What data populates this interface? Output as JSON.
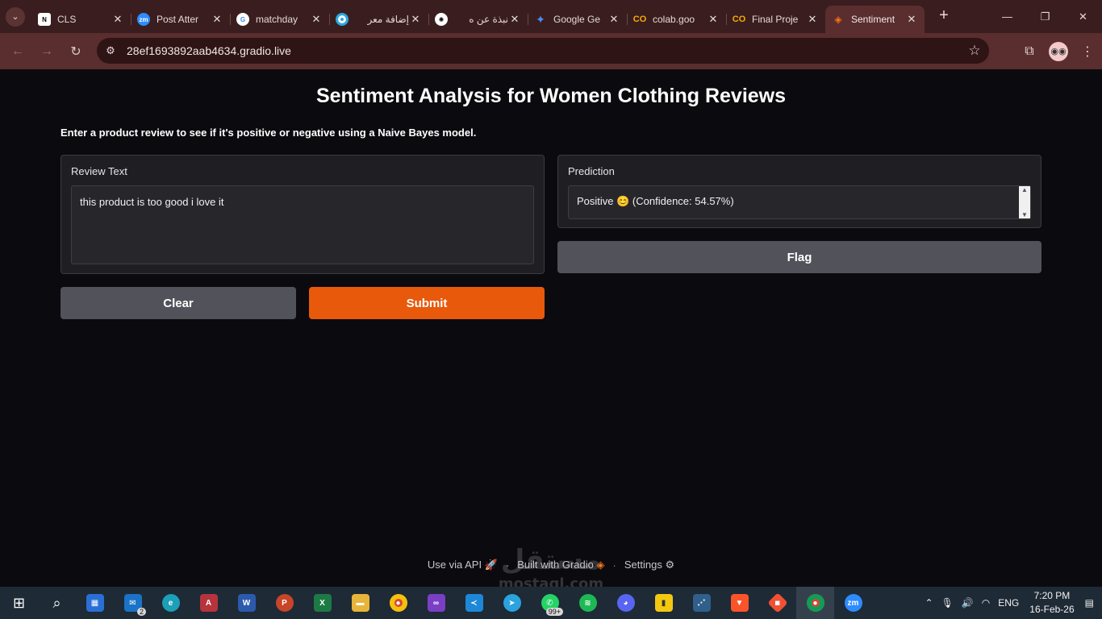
{
  "browser": {
    "tabs": [
      {
        "title": "CLS",
        "icon": "notion-icon",
        "color": "#ffffff"
      },
      {
        "title": "Post Atter",
        "icon": "zoom-icon",
        "color": "#2d8cff"
      },
      {
        "title": "matchday",
        "icon": "google-icon",
        "color": "#4285f4"
      },
      {
        "title": "إضافة معر",
        "icon": "mostaql-icon",
        "color": "#2aa8e0"
      },
      {
        "title": "نبذة عن ه",
        "icon": "chatgpt-icon",
        "color": "#ffffff"
      },
      {
        "title": "Google Ge",
        "icon": "gemini-icon",
        "color": "#4e8cf7"
      },
      {
        "title": "colab.goo",
        "icon": "colab-icon",
        "color": "#f9ab00"
      },
      {
        "title": "Final Proje",
        "icon": "colab-icon",
        "color": "#f9ab00"
      },
      {
        "title": "Sentiment",
        "icon": "gradio-icon",
        "color": "#f97316",
        "active": true
      }
    ],
    "url": "28ef1693892aab4634.gradio.live"
  },
  "app": {
    "title": "Sentiment Analysis for Women Clothing Reviews",
    "description": "Enter a product review to see if it's positive or negative using a Naive Bayes model.",
    "input": {
      "label": "Review Text",
      "value": "this product is too good i love it"
    },
    "output": {
      "label": "Prediction",
      "value": "Positive 😊 (Confidence: 54.57%)"
    },
    "buttons": {
      "clear": "Clear",
      "submit": "Submit",
      "flag": "Flag"
    },
    "colors": {
      "submit": "#e8590c",
      "secondary": "#52525b",
      "background": "#0b0b0f",
      "panel": "#1f1f23"
    }
  },
  "footer": {
    "api": "Use via API",
    "built": "Built with Gradio",
    "settings": "Settings"
  },
  "watermark": {
    "ar": "مستقل",
    "en": "mostaql.com"
  },
  "taskbar": {
    "badges": {
      "mail": "2",
      "whatsapp": "99+"
    },
    "lang": "ENG",
    "time": "7:20 PM",
    "date": "16-Feb-26"
  }
}
